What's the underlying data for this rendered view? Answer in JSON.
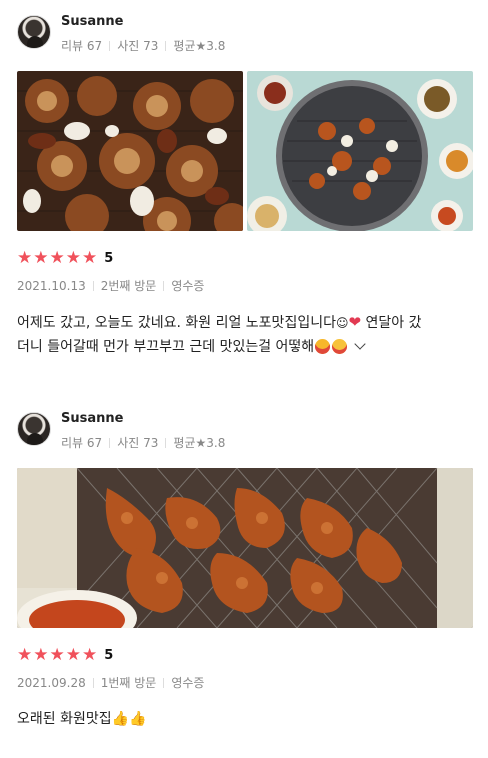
{
  "reviews": [
    {
      "user": {
        "name": "Susanne",
        "review_label": "리뷰",
        "review_count": "67",
        "photo_label": "사진",
        "photo_count": "73",
        "avg_label": "평균★",
        "avg": "3.8"
      },
      "rating": "5",
      "date": "2021.10.13",
      "visit": "2번째 방문",
      "receipt": "영수증",
      "text_line1": "어제도 갔고, 오늘도 갔네요. 화원 리얼 노포맛집입니다",
      "text_line1_tail": "연달아 갔",
      "text_line2": "더니 들어갈때 먼가 부끄부끄 근데 맛있는걸 어떻해",
      "icons": [
        "smile-icon",
        "heart-icon",
        "star-struck-icon",
        "heart-eyes-icon",
        "chevron-down-icon"
      ]
    },
    {
      "user": {
        "name": "Susanne",
        "review_label": "리뷰",
        "review_count": "67",
        "photo_label": "사진",
        "photo_count": "73",
        "avg_label": "평균★",
        "avg": "3.8"
      },
      "rating": "5",
      "date": "2021.09.28",
      "visit": "1번째 방문",
      "receipt": "영수증",
      "text_line1": "오래된 화원맛집",
      "icons": [
        "thumbs-up-icon"
      ]
    }
  ],
  "colors": {
    "star": "#f0515b",
    "meta": "#888888",
    "text": "#222222"
  }
}
